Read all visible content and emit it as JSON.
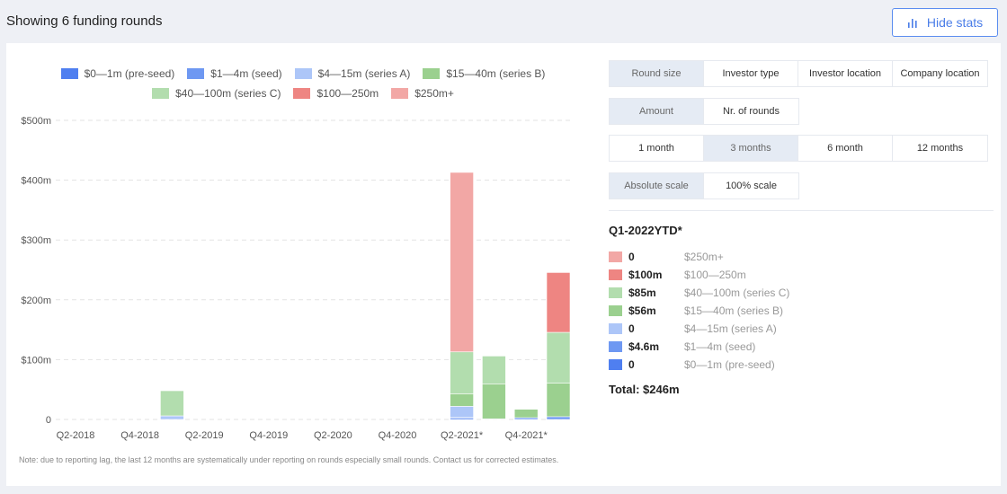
{
  "header": {
    "title": "Showing 6 funding rounds",
    "hide_stats_label": "Hide stats"
  },
  "tabs": {
    "group": [
      {
        "label": "Round size",
        "active": true
      },
      {
        "label": "Investor type"
      },
      {
        "label": "Investor location"
      },
      {
        "label": "Company location"
      }
    ],
    "metric": [
      {
        "label": "Amount",
        "active": true
      },
      {
        "label": "Nr. of rounds"
      }
    ],
    "period": [
      {
        "label": "1 month"
      },
      {
        "label": "3 months",
        "active": true
      },
      {
        "label": "6 month"
      },
      {
        "label": "12 months"
      }
    ],
    "scale": [
      {
        "label": "Absolute scale",
        "active": true
      },
      {
        "label": "100% scale"
      }
    ]
  },
  "stats": {
    "title": "Q1-2022YTD*",
    "rows": [
      {
        "value": "0",
        "label": "$250m+",
        "color": "#f2a7a5"
      },
      {
        "value": "$100m",
        "label": "$100—250m",
        "color": "#ee8582"
      },
      {
        "value": "$85m",
        "label": "$40—100m (series C)",
        "color": "#b2ddae"
      },
      {
        "value": "$56m",
        "label": "$15—40m (series B)",
        "color": "#9bd08f"
      },
      {
        "value": "0",
        "label": "$4—15m (series A)",
        "color": "#adc6f8"
      },
      {
        "value": "$4.6m",
        "label": "$1—4m (seed)",
        "color": "#6e98f2"
      },
      {
        "value": "0",
        "label": "$0—1m (pre-seed)",
        "color": "#4f7ff0"
      }
    ],
    "total": "Total: $246m"
  },
  "note": "Note: due to reporting lag, the last 12 months are systematically under reporting on rounds especially small rounds. Contact us for corrected estimates.",
  "chart_data": {
    "type": "bar",
    "stacked": true,
    "categories": [
      "Q2-2018",
      "Q3-2018",
      "Q4-2018",
      "Q1-2019",
      "Q2-2019",
      "Q3-2019",
      "Q4-2019",
      "Q1-2020",
      "Q2-2020",
      "Q3-2020",
      "Q4-2020",
      "Q1-2021",
      "Q2-2021*",
      "Q3-2021*",
      "Q4-2021*",
      "Q1-2022"
    ],
    "tick_labels": [
      "Q2-2018",
      "Q4-2018",
      "Q2-2019",
      "Q4-2019",
      "Q2-2020",
      "Q4-2020",
      "Q2-2021*",
      "Q4-2021*"
    ],
    "ytick_labels": [
      "0",
      "$100m",
      "$200m",
      "$300m",
      "$400m",
      "$500m"
    ],
    "ylim": [
      0,
      500
    ],
    "grid": true,
    "legend_position": "top",
    "series": [
      {
        "name": "$0—1m (pre-seed)",
        "color": "#4f7ff0",
        "values": [
          0,
          0,
          0,
          0,
          0,
          0,
          0,
          0,
          0,
          0,
          0,
          0,
          2,
          0,
          0,
          0
        ]
      },
      {
        "name": "$1—4m (seed)",
        "color": "#6e98f2",
        "values": [
          0,
          0,
          0,
          0,
          0,
          0,
          0,
          0,
          0,
          0,
          0,
          0,
          2,
          1,
          3,
          4.6
        ]
      },
      {
        "name": "$4—15m (series A)",
        "color": "#adc6f8",
        "values": [
          0,
          0,
          0,
          6,
          0,
          0,
          0,
          0,
          0,
          0,
          0,
          0,
          18,
          0,
          0,
          0
        ]
      },
      {
        "name": "$15—40m (series B)",
        "color": "#9bd08f",
        "values": [
          0,
          0,
          0,
          0,
          0,
          0,
          0,
          0,
          0,
          0,
          0,
          0,
          21,
          58,
          14,
          56
        ]
      },
      {
        "name": "$40—100m (series C)",
        "color": "#b2ddae",
        "values": [
          0,
          0,
          0,
          42,
          0,
          0,
          0,
          0,
          0,
          0,
          0,
          0,
          70,
          47,
          0,
          85
        ]
      },
      {
        "name": "$100—250m",
        "color": "#ee8582",
        "values": [
          0,
          0,
          0,
          0,
          0,
          0,
          0,
          0,
          0,
          0,
          0,
          0,
          0,
          0,
          0,
          100
        ]
      },
      {
        "name": "$250m+",
        "color": "#f2a7a5",
        "values": [
          0,
          0,
          0,
          0,
          0,
          0,
          0,
          0,
          0,
          0,
          0,
          0,
          300,
          0,
          0,
          0
        ]
      }
    ]
  }
}
